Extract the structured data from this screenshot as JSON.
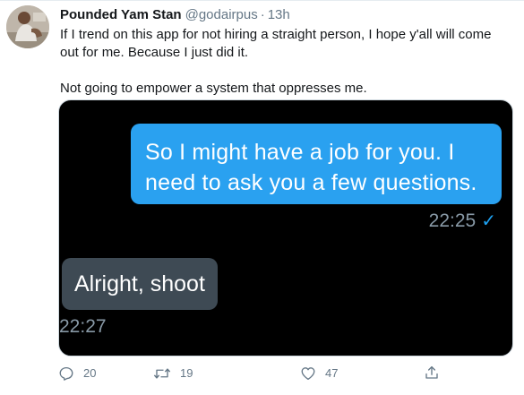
{
  "tweet": {
    "display_name": "Pounded Yam Stan",
    "handle": "@godairpus",
    "separator": "·",
    "time": "13h",
    "text_line1": "If I trend on this app for not hiring a straight person, I hope y'all will come out for me. Because I just did it.",
    "text_line2": "Not going to empower a system that oppresses me.",
    "avatar_icon": "profile-photo"
  },
  "media": {
    "outgoing_message": "So I might have a job for you. I need to ask you a few questions.",
    "outgoing_time": "22:25",
    "outgoing_check": "✓",
    "incoming_message": "Alright, shoot",
    "incoming_time": "22:27",
    "colors": {
      "background": "#000000",
      "outgoing_bubble": "#2aa1f0",
      "incoming_bubble": "#3e4a54",
      "check": "#1da1f2"
    }
  },
  "actions": {
    "reply_icon": "reply-icon",
    "reply_count": "20",
    "retweet_icon": "retweet-icon",
    "retweet_count": "19",
    "like_icon": "heart-icon",
    "like_count": "47",
    "share_icon": "share-icon"
  }
}
